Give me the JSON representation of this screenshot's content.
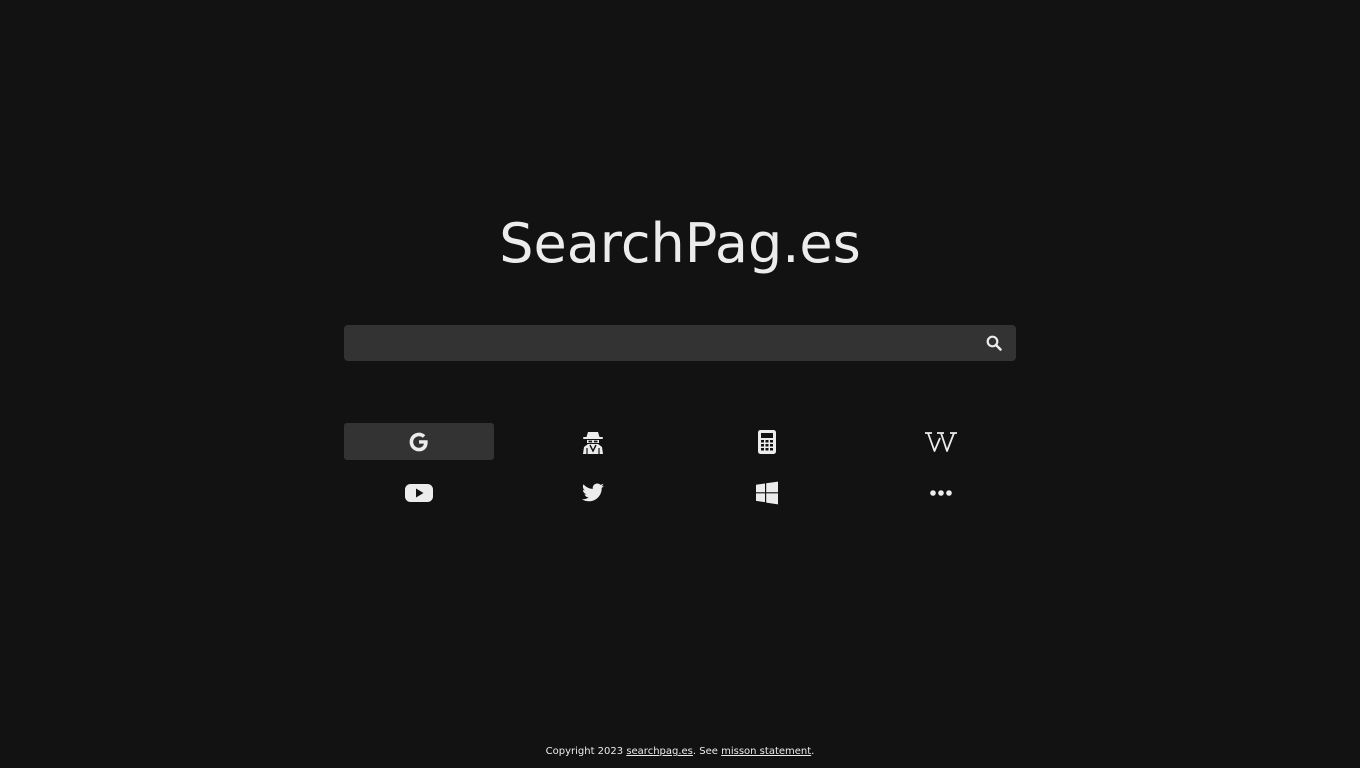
{
  "site": {
    "title": "SearchPag.es"
  },
  "search": {
    "value": "",
    "placeholder": "",
    "button_icon": "search-icon"
  },
  "engines": [
    {
      "name": "Google",
      "icon": "google-icon",
      "active": true
    },
    {
      "name": "Incognito",
      "icon": "incognito-icon",
      "active": false
    },
    {
      "name": "Calculator",
      "icon": "calculator-icon",
      "active": false
    },
    {
      "name": "Wikipedia",
      "icon": "wikipedia-icon",
      "active": false
    },
    {
      "name": "YouTube",
      "icon": "youtube-icon",
      "active": false
    },
    {
      "name": "Twitter",
      "icon": "twitter-icon",
      "active": false
    },
    {
      "name": "Windows",
      "icon": "windows-icon",
      "active": false
    },
    {
      "name": "More",
      "icon": "more-icon",
      "active": false
    }
  ],
  "footer": {
    "prefix": "Copyright 2023 ",
    "site_link": "searchpag.es",
    "middle": ". See ",
    "mission_link": "misson statement",
    "suffix": "."
  },
  "colors": {
    "background": "#121212",
    "surface": "#333333",
    "text": "#ececec"
  }
}
